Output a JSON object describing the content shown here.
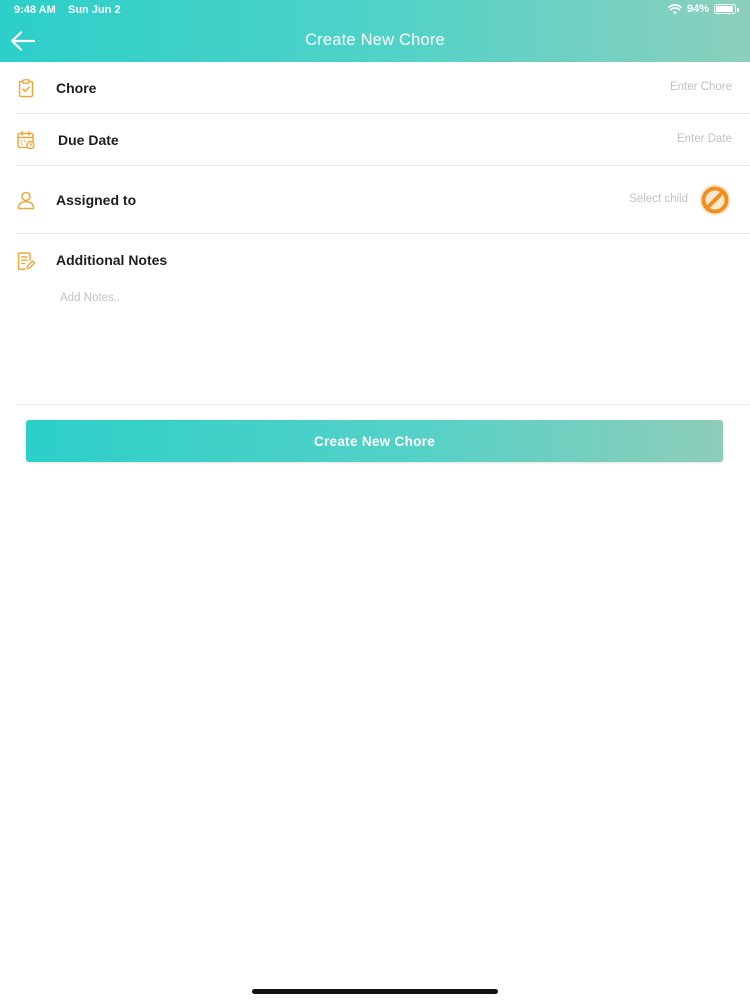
{
  "status_bar": {
    "time": "9:48 AM",
    "date": "Sun Jun 2",
    "battery": "94%",
    "battery_level": 0.94
  },
  "header": {
    "title": "Create New Chore",
    "back_icon": "arrow-left-icon"
  },
  "form": {
    "chore": {
      "label": "Chore",
      "placeholder": "Enter Chore",
      "value": "",
      "icon": "clipboard-check-icon"
    },
    "due_date": {
      "label": "Due Date",
      "placeholder": "Enter Date",
      "value": "",
      "icon": "calendar-clock-icon"
    },
    "assigned_to": {
      "label": "Assigned to",
      "placeholder": "Select child",
      "icon": "person-icon",
      "avatar_icon": "no-child-icon"
    },
    "notes": {
      "label": "Additional Notes",
      "placeholder": "Add Notes..",
      "value": "",
      "icon": "notes-pencil-icon"
    }
  },
  "submit": {
    "label": "Create New Chore"
  },
  "colors": {
    "accent_start": "#2ccfc9",
    "accent_end": "#8ccfbd",
    "icon_orange": "#f0a73a"
  }
}
